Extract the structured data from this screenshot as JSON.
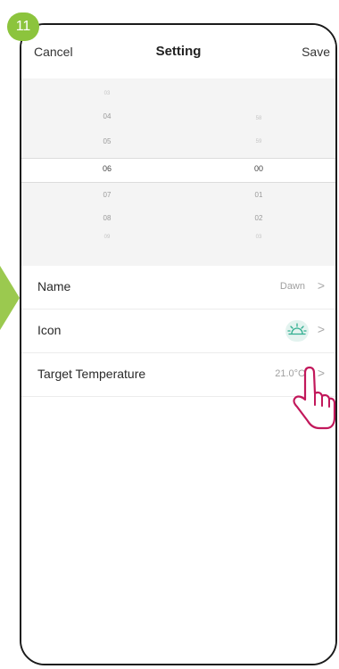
{
  "step": {
    "number": "11"
  },
  "nav": {
    "cancel_label": "Cancel",
    "title": "Setting",
    "save_label": "Save"
  },
  "time_picker": {
    "hours": [
      "03",
      "04",
      "05",
      "06",
      "07",
      "08",
      "09"
    ],
    "minutes": [
      "58",
      "59",
      "00",
      "01",
      "02",
      "03"
    ],
    "selected_hour": "06",
    "selected_minute": "00"
  },
  "settings": {
    "name": {
      "label": "Name",
      "value": "Dawn",
      "chevron": ">"
    },
    "icon": {
      "label": "Icon",
      "icon": "sunrise-icon",
      "chevron": ">"
    },
    "target_temperature": {
      "label": "Target Temperature",
      "value": "21.0°C",
      "chevron": ">"
    }
  },
  "colors": {
    "badge": "#8cc43d",
    "arrow": "#9bc94f",
    "icon_accent": "#2fae8f",
    "hand": "#c2185b"
  }
}
